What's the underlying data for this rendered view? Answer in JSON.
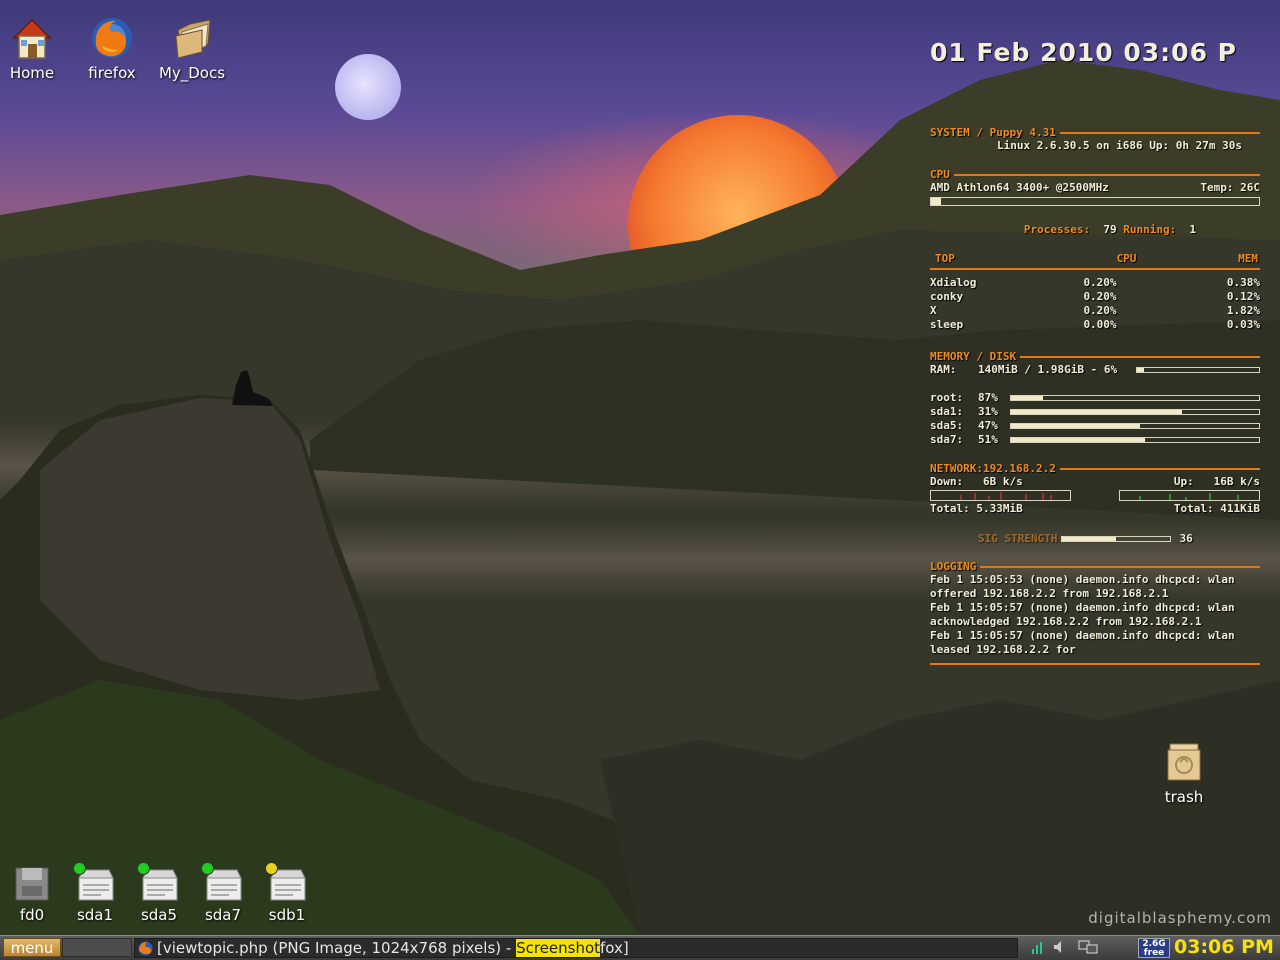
{
  "desktop": {
    "icons": [
      {
        "label": "Home",
        "icon": "home-icon"
      },
      {
        "label": "firefox",
        "icon": "firefox-icon"
      },
      {
        "label": "My_Docs",
        "icon": "folder-icon"
      },
      {
        "label": "trash",
        "icon": "trash-icon"
      }
    ],
    "drives": [
      {
        "label": "fd0",
        "icon": "floppy-drive-icon",
        "status": null
      },
      {
        "label": "sda1",
        "icon": "hard-drive-icon",
        "status": "#22cc22"
      },
      {
        "label": "sda5",
        "icon": "hard-drive-icon",
        "status": "#22cc22"
      },
      {
        "label": "sda7",
        "icon": "hard-drive-icon",
        "status": "#22cc22"
      },
      {
        "label": "sdb1",
        "icon": "hard-drive-icon",
        "status": "#e8d020"
      }
    ],
    "watermark": "digitalblasphemy.com"
  },
  "conky": {
    "clock": "01 Feb 2010    03:06 P",
    "system": {
      "heading": "SYSTEM /  Puppy 4.31",
      "kernel_line": "Linux 2.6.30.5 on i686  Up: 0h 27m 30s"
    },
    "cpu": {
      "heading": "CPU",
      "model": "AMD Athlon64 3400+  @2500MHz",
      "temp": "Temp:  26C",
      "usage_fraction": 0.03,
      "processes_label": "Processes:",
      "processes_value": "79",
      "running_label": "Running:",
      "running_value": "1"
    },
    "top": {
      "headers": [
        "TOP",
        "CPU",
        "MEM"
      ],
      "rows": [
        {
          "name": "Xdialog",
          "cpu": "0.20%",
          "mem": "0.38%"
        },
        {
          "name": "conky",
          "cpu": "0.20%",
          "mem": "0.12%"
        },
        {
          "name": "X",
          "cpu": "0.20%",
          "mem": "1.82%"
        },
        {
          "name": "sleep",
          "cpu": "0.00%",
          "mem": "0.03%"
        }
      ]
    },
    "memory": {
      "heading": "MEMORY / DISK",
      "ram_label": "RAM:",
      "ram_value": "140MiB / 1.98GiB - 6%",
      "ram_fraction": 0.06,
      "disks": [
        {
          "label": "root:",
          "percent": "87%",
          "fraction": 0.13
        },
        {
          "label": "sda1:",
          "percent": "31%",
          "fraction": 0.69
        },
        {
          "label": "sda5:",
          "percent": "47%",
          "fraction": 0.52
        },
        {
          "label": "sda7:",
          "percent": "51%",
          "fraction": 0.54
        }
      ]
    },
    "network": {
      "heading": "NETWORK:192.168.2.2",
      "down_label": "Down:",
      "down_value": "6B   k/s",
      "up_label": "Up:",
      "up_value": "16B   k/s",
      "total_down": "Total: 5.33MiB",
      "total_up": "Total: 411KiB"
    },
    "signal": {
      "label": "SIG STRENGTH",
      "value": "36",
      "fraction": 0.5
    },
    "logging": {
      "heading": "LOGGING",
      "lines": [
        "Feb  1 15:05:53 (none) daemon.info dhcpcd: wlan",
        "offered 192.168.2.2 from 192.168.2.1",
        "Feb  1 15:05:57 (none) daemon.info dhcpcd: wlan",
        "acknowledged 192.168.2.2 from 192.168.2.1",
        "Feb  1 15:05:57 (none) daemon.info dhcpcd: wlan",
        "leased 192.168.2.2 for"
      ]
    }
  },
  "taskbar": {
    "menu_label": "menu",
    "task_prefix": "[viewtopic.php (PNG Image, 1024x768 pixels) - ",
    "task_highlight": "Screenshot",
    "task_suffix": "fox]",
    "free_line1": "2.6G",
    "free_line2": "free",
    "clock": "03:06 PM",
    "tray_icons": [
      "network-icon",
      "volume-icon",
      "display-icon"
    ]
  }
}
